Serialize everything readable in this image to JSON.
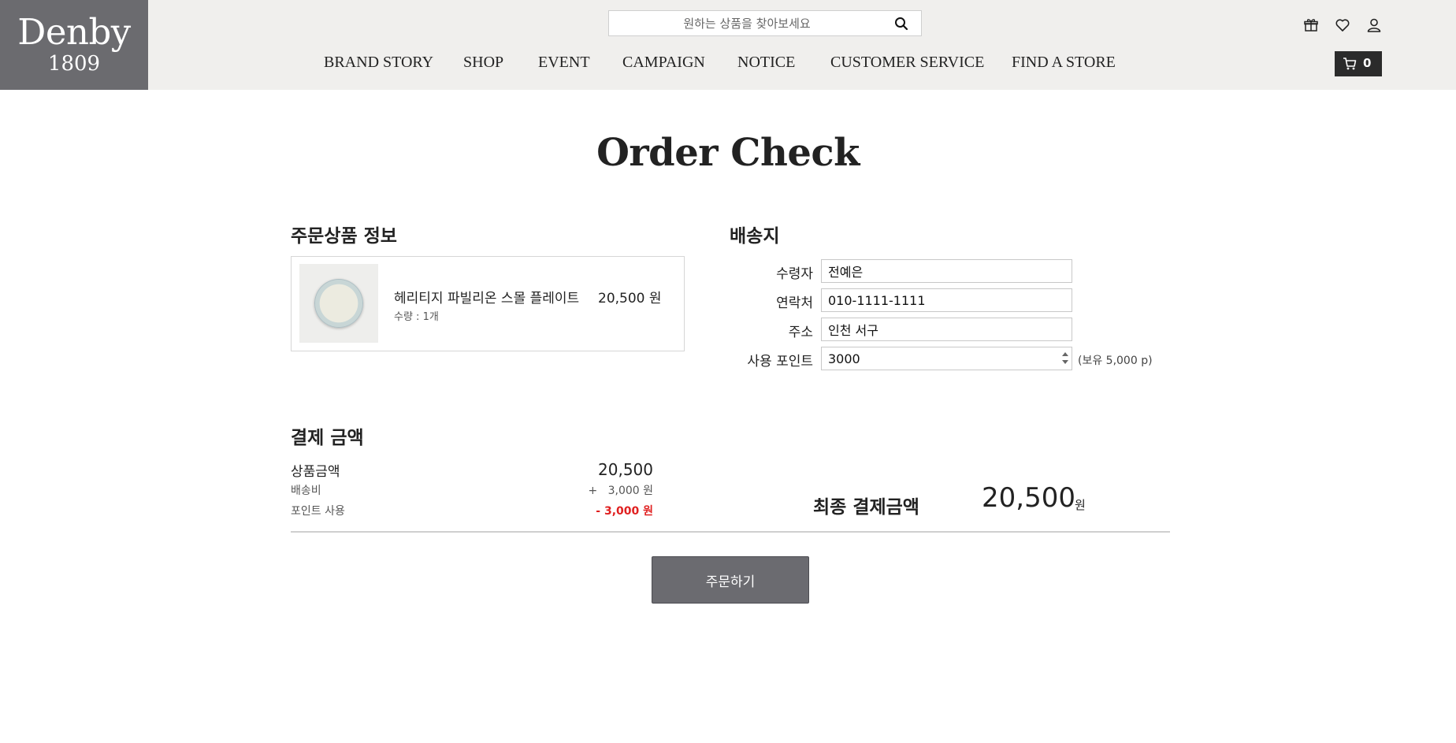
{
  "header": {
    "logo_name": "Denby",
    "logo_year": "1809",
    "search_placeholder": "원하는 상품을 찾아보세요",
    "nav": [
      "BRAND STORY",
      "SHOP",
      "EVENT",
      "CAMPAIGN",
      "NOTICE",
      "CUSTOMER SERVICE",
      "FIND A STORE"
    ],
    "icons": [
      "gift-icon",
      "heart-icon",
      "user-icon",
      "cart-icon"
    ],
    "cart_count": "0"
  },
  "page_title": "Order Check",
  "product_section": {
    "title": "주문상품 정보",
    "item": {
      "name": "헤리티지 파빌리온 스몰 플레이트",
      "qty": "수량 : 1개",
      "price": "20,500 원"
    }
  },
  "shipping": {
    "title": "배송지",
    "recipient_label": "수령자",
    "recipient_value": "전예은",
    "phone_label": "연락처",
    "phone_value": "010-1111-1111",
    "address_label": "주소",
    "address_value": "인천 서구",
    "points_label": "사용 포인트",
    "points_value": "3000",
    "points_have": "(보유 5,000 p)"
  },
  "payment": {
    "title": "결제 금액",
    "product_label": "상품금액",
    "product_value": "20,500",
    "shipping_label": "배송비",
    "shipping_value": "+   3,000 원",
    "points_label": "포인트 사용",
    "points_value": "- 3,000 원",
    "final_label": "최종 결제금액",
    "final_amount": "20,500",
    "final_unit": "원"
  },
  "order_button": "주문하기",
  "colors": {
    "header_bg": "#f0efed",
    "logo_bg": "#6b6b6f",
    "button_bg": "#6b6b70",
    "discount_red": "#e02020"
  }
}
